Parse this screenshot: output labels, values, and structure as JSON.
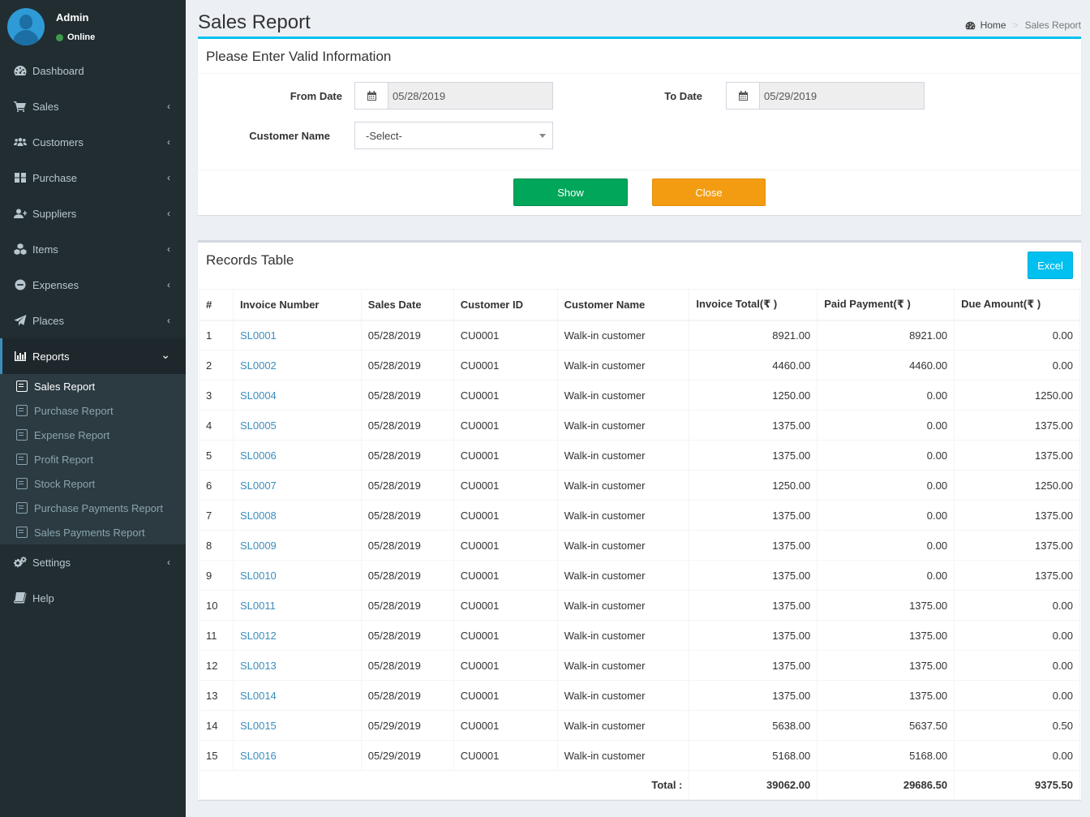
{
  "user": {
    "name": "Admin",
    "status": "Online"
  },
  "sidebar": {
    "items": [
      {
        "label": "Dashboard"
      },
      {
        "label": "Sales"
      },
      {
        "label": "Customers"
      },
      {
        "label": "Purchase"
      },
      {
        "label": "Suppliers"
      },
      {
        "label": "Items"
      },
      {
        "label": "Expenses"
      },
      {
        "label": "Places"
      },
      {
        "label": "Reports"
      },
      {
        "label": "Settings"
      },
      {
        "label": "Help"
      }
    ],
    "reports_sub": [
      {
        "label": "Sales Report"
      },
      {
        "label": "Purchase Report"
      },
      {
        "label": "Expense Report"
      },
      {
        "label": "Profit Report"
      },
      {
        "label": "Stock Report"
      },
      {
        "label": "Purchase Payments Report"
      },
      {
        "label": "Sales Payments Report"
      }
    ]
  },
  "header": {
    "title": "Sales Report",
    "breadcrumb_home": "Home",
    "breadcrumb_current": "Sales Report"
  },
  "form": {
    "title": "Please Enter Valid Information",
    "from_date_label": "From Date",
    "from_date_value": "05/28/2019",
    "to_date_label": "To Date",
    "to_date_value": "05/29/2019",
    "customer_label": "Customer Name",
    "customer_value": "-Select-",
    "show_label": "Show",
    "close_label": "Close"
  },
  "records": {
    "title": "Records Table",
    "excel_label": "Excel",
    "columns": [
      "#",
      "Invoice Number",
      "Sales Date",
      "Customer ID",
      "Customer Name",
      "Invoice Total(₹ )",
      "Paid Payment(₹ )",
      "Due Amount(₹ )"
    ],
    "rows": [
      [
        "1",
        "SL0001",
        "05/28/2019",
        "CU0001",
        "Walk-in customer",
        "8921.00",
        "8921.00",
        "0.00"
      ],
      [
        "2",
        "SL0002",
        "05/28/2019",
        "CU0001",
        "Walk-in customer",
        "4460.00",
        "4460.00",
        "0.00"
      ],
      [
        "3",
        "SL0004",
        "05/28/2019",
        "CU0001",
        "Walk-in customer",
        "1250.00",
        "0.00",
        "1250.00"
      ],
      [
        "4",
        "SL0005",
        "05/28/2019",
        "CU0001",
        "Walk-in customer",
        "1375.00",
        "0.00",
        "1375.00"
      ],
      [
        "5",
        "SL0006",
        "05/28/2019",
        "CU0001",
        "Walk-in customer",
        "1375.00",
        "0.00",
        "1375.00"
      ],
      [
        "6",
        "SL0007",
        "05/28/2019",
        "CU0001",
        "Walk-in customer",
        "1250.00",
        "0.00",
        "1250.00"
      ],
      [
        "7",
        "SL0008",
        "05/28/2019",
        "CU0001",
        "Walk-in customer",
        "1375.00",
        "0.00",
        "1375.00"
      ],
      [
        "8",
        "SL0009",
        "05/28/2019",
        "CU0001",
        "Walk-in customer",
        "1375.00",
        "0.00",
        "1375.00"
      ],
      [
        "9",
        "SL0010",
        "05/28/2019",
        "CU0001",
        "Walk-in customer",
        "1375.00",
        "0.00",
        "1375.00"
      ],
      [
        "10",
        "SL0011",
        "05/28/2019",
        "CU0001",
        "Walk-in customer",
        "1375.00",
        "1375.00",
        "0.00"
      ],
      [
        "11",
        "SL0012",
        "05/28/2019",
        "CU0001",
        "Walk-in customer",
        "1375.00",
        "1375.00",
        "0.00"
      ],
      [
        "12",
        "SL0013",
        "05/28/2019",
        "CU0001",
        "Walk-in customer",
        "1375.00",
        "1375.00",
        "0.00"
      ],
      [
        "13",
        "SL0014",
        "05/28/2019",
        "CU0001",
        "Walk-in customer",
        "1375.00",
        "1375.00",
        "0.00"
      ],
      [
        "14",
        "SL0015",
        "05/29/2019",
        "CU0001",
        "Walk-in customer",
        "5638.00",
        "5637.50",
        "0.50"
      ],
      [
        "15",
        "SL0016",
        "05/29/2019",
        "CU0001",
        "Walk-in customer",
        "5168.00",
        "5168.00",
        "0.00"
      ]
    ],
    "total_label": "Total :",
    "total_invoice": "39062.00",
    "total_paid": "29686.50",
    "total_due": "9375.50"
  },
  "colors": {
    "sidebar_bg": "#222d32",
    "accent": "#3c8dbc",
    "show_button": "#00a65a",
    "close_button": "#f39c12",
    "excel_button": "#00c0ef"
  }
}
